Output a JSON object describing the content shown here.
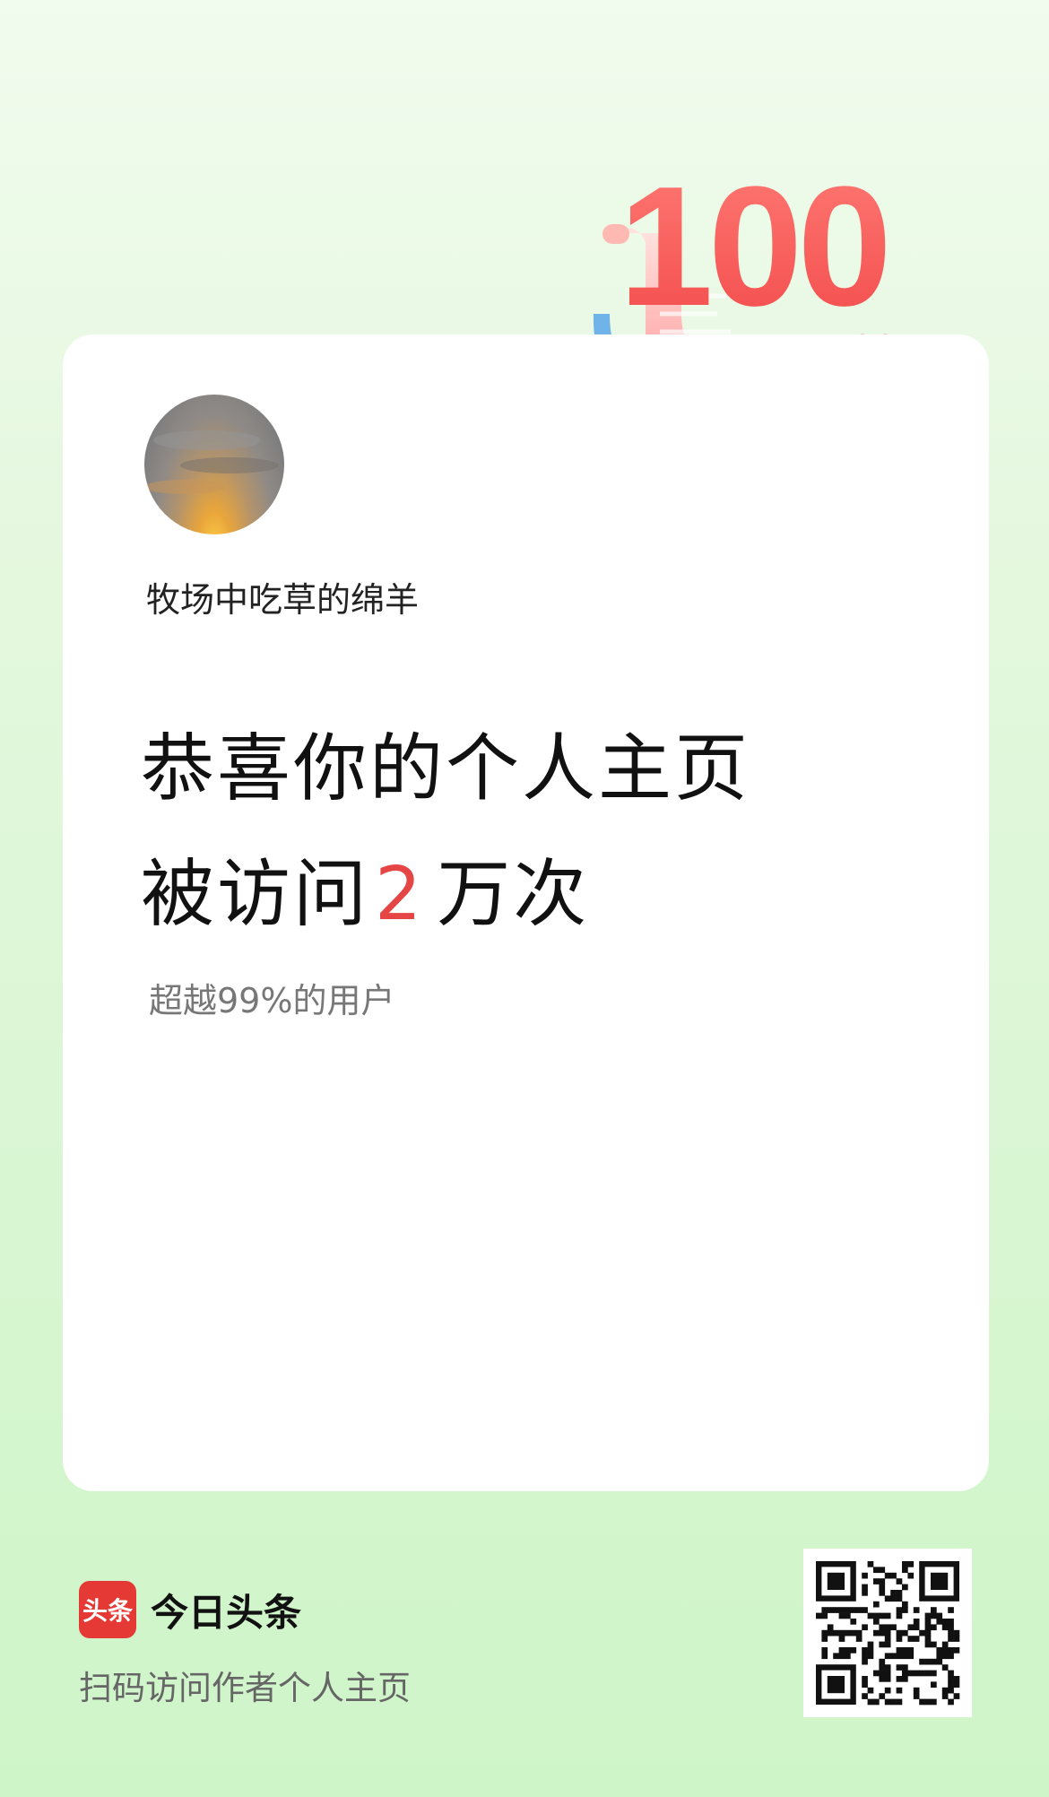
{
  "milestone": {
    "badge_number": "100"
  },
  "profile": {
    "username": "牧场中吃草的绵羊"
  },
  "headline": {
    "line1": "恭喜你的个人主页",
    "line2_prefix": "被访问",
    "visit_count": "2",
    "line2_suffix": "万次"
  },
  "subtitle": "超越99%的用户",
  "footer": {
    "logo_text": "头条",
    "brand_name": "今日头条",
    "scan_hint": "扫码访问作者个人主页"
  },
  "colors": {
    "accent": "#e64545",
    "brand_red": "#e53935",
    "background_green": "#d9f6d3"
  }
}
